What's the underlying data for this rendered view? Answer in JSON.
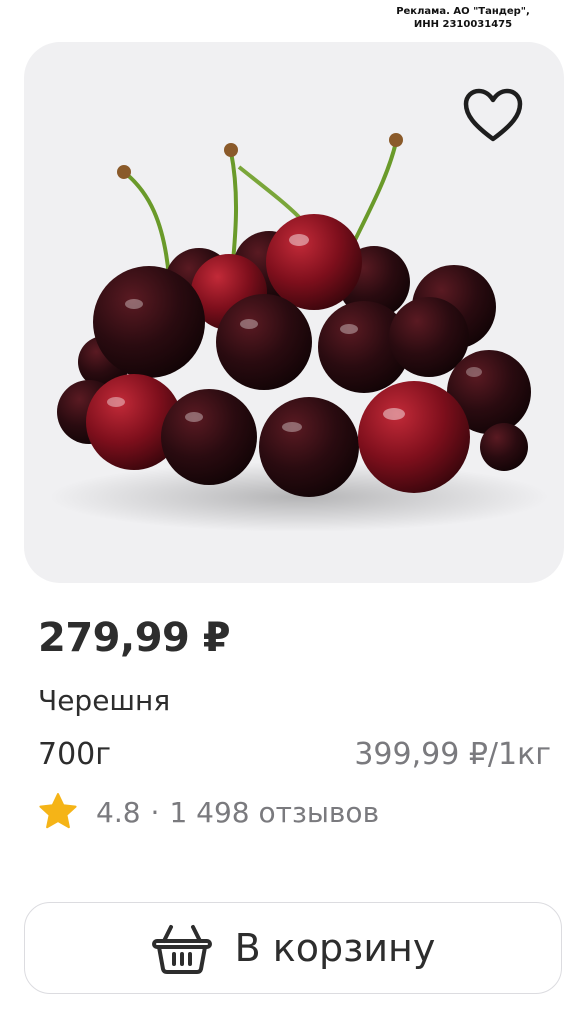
{
  "ad": {
    "line1": "Реклама. АО \"Тандер\",",
    "line2": "ИНН 2310031475"
  },
  "product": {
    "image_icon": "cherries-photo",
    "favorite_icon": "heart-outline-icon",
    "price": "279,99 ₽",
    "name": "Черешня",
    "weight": "700г",
    "unit_price": "399,99 ₽/1кг",
    "rating": {
      "icon": "star-icon",
      "value": "4.8",
      "separator": "·",
      "reviews": "1 498 отзывов"
    }
  },
  "cart": {
    "icon": "basket-icon",
    "label": "В корзину"
  },
  "colors": {
    "card_background": "#f0f0f2",
    "text_primary": "#2d2d2d",
    "text_secondary": "#7a7a7e",
    "star": "#f5b417",
    "border": "#dcdce0"
  }
}
